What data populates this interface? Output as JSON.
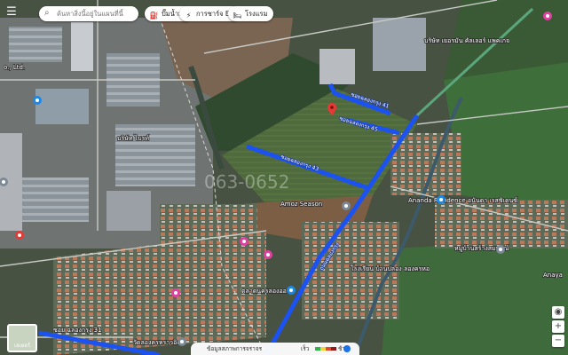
{
  "search": {
    "placeholder": "ค้นหาสิ่งนี้อยู่ในแผนที่นี้"
  },
  "chips": [
    {
      "label": "ปั๊มน้ำมัน",
      "icon": "gas-station-icon"
    },
    {
      "label": "การชาร์จ EV",
      "icon": "ev-charging-icon"
    },
    {
      "label": "โรงแรม",
      "icon": "hotel-icon"
    }
  ],
  "map": {
    "labels": {
      "top_left_ltd": "o., Ltd.",
      "shop_top": "บริษัท เยอรมัน\nคัลเลอร์ แพคเกจ",
      "factory_left": "บริษัท ไบรท์",
      "ananda": "Ananda Residence\nอนันดา เรสซิเดนซ์",
      "market": "ตลาดนครลองอองค์",
      "season": "Amoz Season",
      "village": "หมู่บ้านสร้างสมบูรณ์",
      "anaya": "Anaya",
      "bottom_left": "วัดลองครหราวอิง",
      "school": "โรงเรียน บ้านปลอง\nลองครหอ",
      "street_bottom": "ซอย ฉลองกรุง 31",
      "watermark": "063-0652"
    },
    "roads": {
      "main": "ถนนฉลองกรุง",
      "branch1": "ซอยฉลองกรุง 43",
      "branch2": "ซอยฉลองกรุง 45",
      "branch3": "ซอยฉลองกรุง 41"
    }
  },
  "layers": {
    "label": "เลเยอร์"
  },
  "bottombar": {
    "traffic": "ข้อมูลสภาพการจราจร",
    "speed": "เร็ว",
    "slow": "ช้า"
  },
  "colors": {
    "route": "#1b52f0",
    "red_pin": "#e53935",
    "pink_poi": "#e040a0"
  }
}
